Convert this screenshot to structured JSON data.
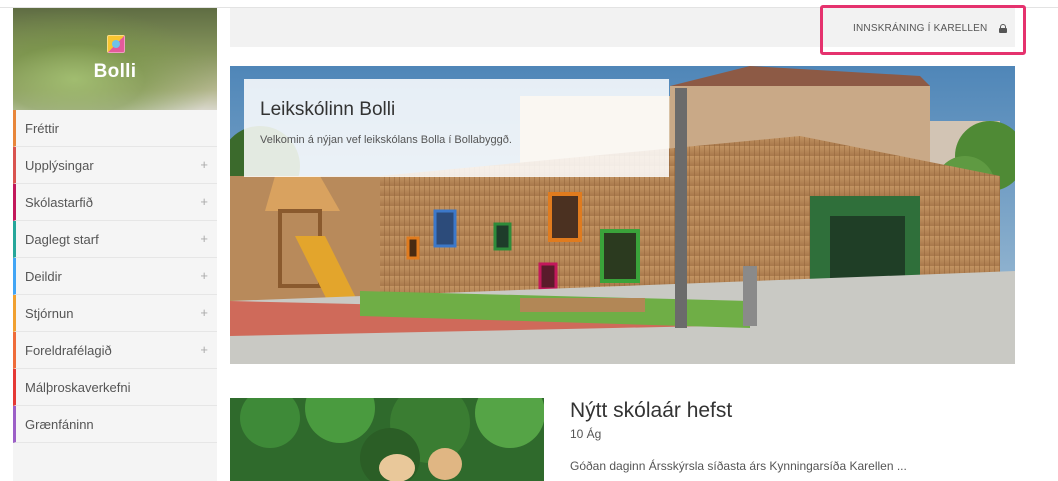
{
  "site": {
    "name": "Bolli",
    "logo_icon": "school-logo-icon"
  },
  "nav": {
    "items": [
      {
        "label": "Fréttir",
        "has_children": false,
        "color": "#e8863a",
        "expand_symbol": ""
      },
      {
        "label": "Upplýsingar",
        "has_children": true,
        "color": "#d9534f",
        "expand_symbol": "+"
      },
      {
        "label": "Skólastarfið",
        "has_children": true,
        "color": "#c2185b",
        "expand_symbol": "+"
      },
      {
        "label": "Daglegt starf",
        "has_children": true,
        "color": "#26a69a",
        "expand_symbol": "+"
      },
      {
        "label": "Deildir",
        "has_children": true,
        "color": "#42a5f5",
        "expand_symbol": "+"
      },
      {
        "label": "Stjórnun",
        "has_children": true,
        "color": "#f0a030",
        "expand_symbol": "+"
      },
      {
        "label": "Foreldrafélagið",
        "has_children": true,
        "color": "#ef6c3a",
        "expand_symbol": "+"
      },
      {
        "label": "Málþroskaverkefni",
        "has_children": false,
        "color": "#e53935",
        "expand_symbol": ""
      },
      {
        "label": "Grænfáninn",
        "has_children": false,
        "color": "#9c5fc7",
        "expand_symbol": ""
      }
    ]
  },
  "topbar": {
    "login_label": "INNSKRÁNING Í KARELLEN",
    "login_icon": "lock-icon",
    "highlight_color": "#e5326e"
  },
  "hero": {
    "title": "Leikskólinn Bolli",
    "subtitle": "Velkomin á nýjan vef leikskólans Bolla í Bollabyggð."
  },
  "news": {
    "title": "Nýtt skólaár hefst",
    "date": "10 Ág",
    "excerpt": "Góðan daginn Ársskýrsla síðasta árs Kynningarsíða Karellen ..."
  }
}
